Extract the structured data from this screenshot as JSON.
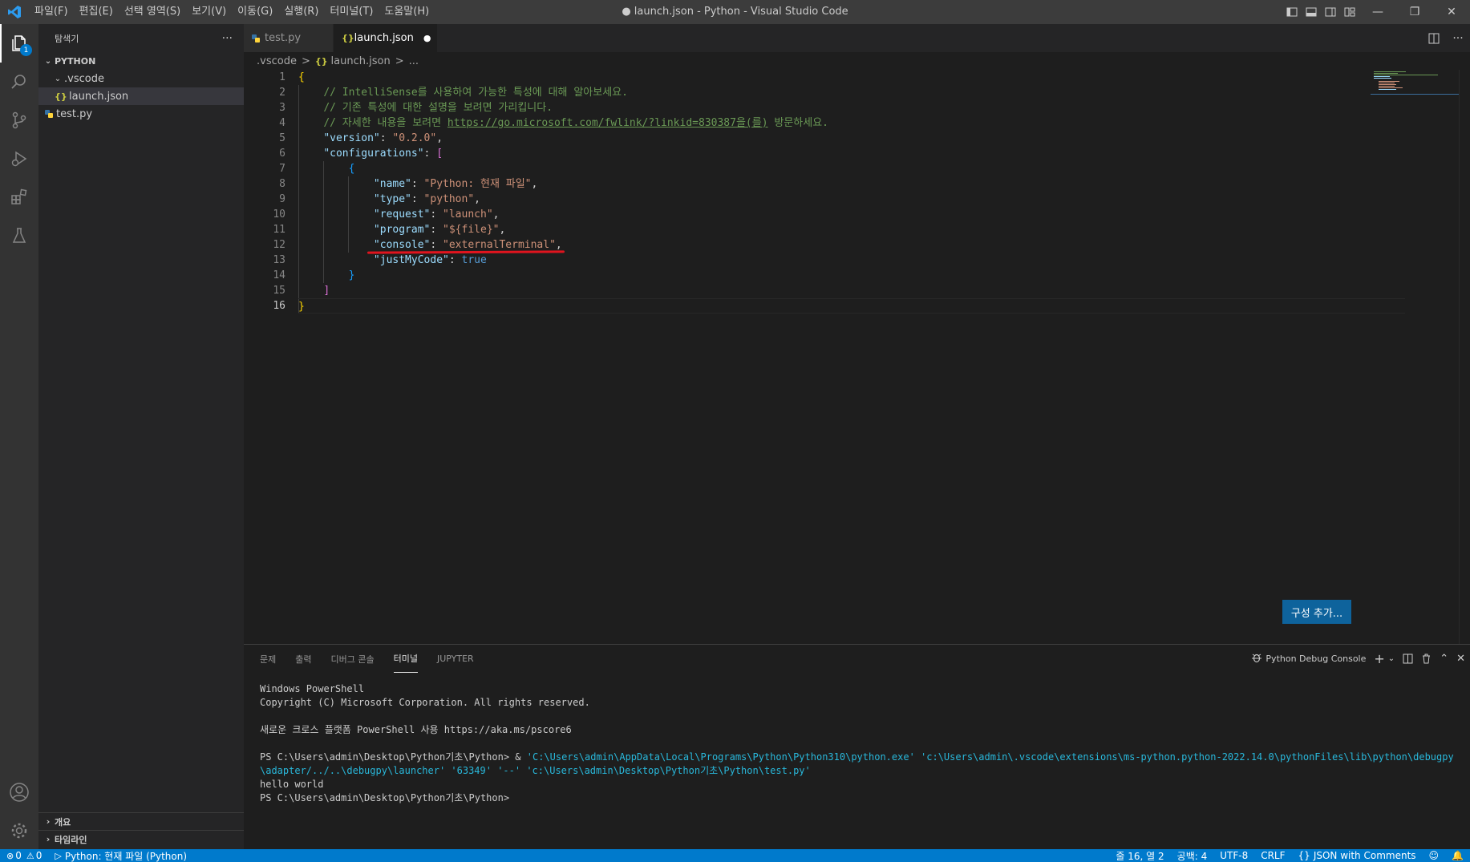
{
  "titlebar": {
    "window_title": "● launch.json - Python - Visual Studio Code",
    "menu": [
      "파일(F)",
      "편집(E)",
      "선택 영역(S)",
      "보기(V)",
      "이동(G)",
      "실행(R)",
      "터미널(T)",
      "도움말(H)"
    ]
  },
  "activity": {
    "explorer_badge": "1"
  },
  "sidebar": {
    "header": "탐색기",
    "more": "···",
    "section": "PYTHON",
    "folder": ".vscode",
    "file_launch": "launch.json",
    "file_test": "test.py",
    "outline": "개요",
    "timeline": "타임라인"
  },
  "tabs": {
    "tab1": "test.py",
    "tab2": "launch.json",
    "tab2_dirty": "●"
  },
  "breadcrumb": {
    "part1": ".vscode",
    "sep1": ">",
    "part2": "launch.json",
    "sep2": ">",
    "part3": "..."
  },
  "editor": {
    "line_numbers": [
      "1",
      "2",
      "3",
      "4",
      "5",
      "6",
      "7",
      "8",
      "9",
      "10",
      "11",
      "12",
      "13",
      "14",
      "15",
      "16"
    ],
    "c1": "// IntelliSense를 사용하여 가능한 특성에 대해 알아보세요.",
    "c2": "// 기존 특성에 대한 설명을 보려면 가리킵니다.",
    "c3_pre": "// 자세한 내용을 보려면 ",
    "c3_link": "https://go.microsoft.com/fwlink/?linkid=830387을(를)",
    "c3_post": " 방문하세요.",
    "k_version": "\"version\"",
    "v_version": "\"0.2.0\"",
    "k_configurations": "\"configurations\"",
    "k_name": "\"name\"",
    "v_name": "\"Python: 현재 파일\"",
    "k_type": "\"type\"",
    "v_type": "\"python\"",
    "k_request": "\"request\"",
    "v_request": "\"launch\"",
    "k_program": "\"program\"",
    "v_program": "\"${file}\"",
    "k_console": "\"console\"",
    "v_console": "\"externalTerminal\"",
    "k_justmycode": "\"justMyCode\"",
    "v_justmycode": "true",
    "add_config_button": "구성 추가..."
  },
  "panel": {
    "tabs": [
      "문제",
      "출력",
      "디버그 콘솔",
      "터미널",
      "JUPYTER"
    ],
    "terminal_name": "Python Debug Console",
    "terminal_lines": {
      "l1": "Windows PowerShell",
      "l2": "Copyright (C) Microsoft Corporation. All rights reserved.",
      "l3": "새로운 크로스 플랫폼 PowerShell 사용 https://aka.ms/pscore6",
      "l4_prompt": "PS C:\\Users\\admin\\Desktop\\Python기초\\Python> ",
      "l4_amp": " & ",
      "l4_cmd": "'C:\\Users\\admin\\AppData\\Local\\Programs\\Python\\Python310\\python.exe' 'c:\\Users\\admin\\.vscode\\extensions\\ms-python.python-2022.14.0\\pythonFiles\\lib\\python\\debugpy\\adapter/../..\\debugpy\\launcher' '63349' '--' 'c:\\Users\\admin\\Desktop\\Python기초\\Python\\test.py'",
      "l5": "hello world",
      "l6": "PS C:\\Users\\admin\\Desktop\\Python기초\\Python>"
    }
  },
  "statusbar": {
    "errors": "0",
    "warnings": "0",
    "run_config": "Python: 현재 파일 (Python)",
    "position": "줄 16, 열 2",
    "indent": "공백: 4",
    "encoding": "UTF-8",
    "eol": "CRLF",
    "language": "JSON with Comments"
  },
  "colors": {
    "accent": "#007acc",
    "underline": "#e0141e",
    "button": "#0e639c"
  }
}
